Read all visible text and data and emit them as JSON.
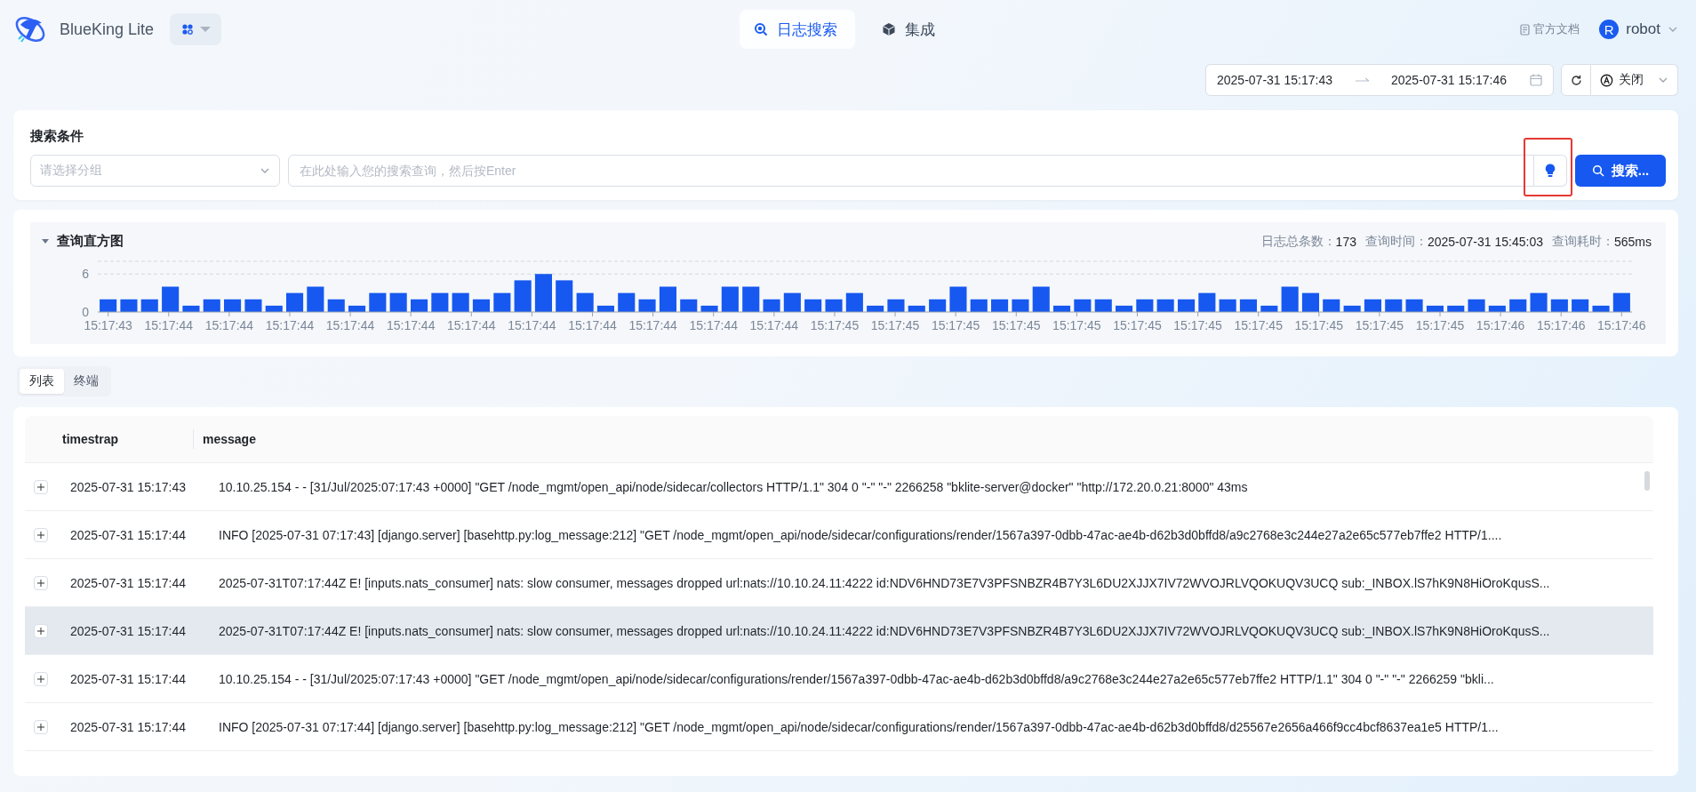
{
  "header": {
    "brand": "BlueKing Lite",
    "nav_tabs": [
      {
        "label": "日志搜索",
        "selected": true,
        "kind": "search"
      },
      {
        "label": "集成",
        "selected": false,
        "kind": "cube"
      }
    ],
    "docs_link": "官方文档",
    "user": {
      "avatar": "R",
      "name": "robot"
    }
  },
  "time_range": {
    "start": "2025-07-31 15:17:43",
    "end": "2025-07-31 15:17:46",
    "auto_refresh": "关闭"
  },
  "search": {
    "title": "搜索条件",
    "group_select": {
      "placeholder": "请选择分组"
    },
    "query": {
      "placeholder": "在此处输入您的搜索查询，然后按Enter"
    },
    "hint_highlighted": true,
    "search_button": "搜索..."
  },
  "histogram": {
    "title": "查询直方图",
    "expanded": true,
    "stats": [
      {
        "label": "日志总条数：",
        "value": "173"
      },
      {
        "label": "查询时间：",
        "value": "2025-07-31 15:45:03"
      },
      {
        "label": "查询耗时：",
        "value": "565ms"
      }
    ],
    "x_labels": [
      "15:17:43",
      "15:17:44",
      "15:17:44",
      "15:17:44",
      "15:17:44",
      "15:17:44",
      "15:17:44",
      "15:17:44",
      "15:17:44",
      "15:17:44",
      "15:17:44",
      "15:17:44",
      "15:17:45",
      "15:17:45",
      "15:17:45",
      "15:17:45",
      "15:17:45",
      "15:17:45",
      "15:17:45",
      "15:17:45",
      "15:17:45",
      "15:17:45",
      "15:17:45",
      "15:17:46",
      "15:17:46",
      "15:17:46"
    ],
    "chart_data": {
      "type": "bar",
      "ylim": [
        0,
        8
      ],
      "yticks": [
        0,
        6
      ],
      "values": [
        2,
        2,
        2,
        4,
        1,
        2,
        2,
        2,
        1,
        3,
        4,
        2,
        1,
        3,
        3,
        2,
        3,
        3,
        2,
        3,
        5,
        6,
        5,
        3,
        1,
        3,
        2,
        4,
        2,
        1,
        4,
        4,
        2,
        3,
        2,
        2,
        3,
        1,
        2,
        1,
        2,
        4,
        2,
        2,
        2,
        4,
        1,
        2,
        2,
        1,
        2,
        2,
        2,
        3,
        2,
        2,
        1,
        4,
        3,
        2,
        1,
        2,
        2,
        2,
        1,
        1,
        2,
        1,
        2,
        3,
        2,
        2,
        1,
        3
      ]
    }
  },
  "view_tabs": [
    {
      "label": "列表",
      "selected": true
    },
    {
      "label": "终端",
      "selected": false
    }
  ],
  "table": {
    "columns": [
      "timestrap",
      "message"
    ],
    "rows": [
      {
        "timestamp": "2025-07-31 15:17:43",
        "message": "10.10.25.154 - - [31/Jul/2025:07:17:43 +0000] \"GET /node_mgmt/open_api/node/sidecar/collectors HTTP/1.1\" 304 0 \"-\" \"-\" 2266258 \"bklite-server@docker\" \"http://172.20.0.21:8000\" 43ms",
        "hovered": false
      },
      {
        "timestamp": "2025-07-31 15:17:44",
        "message": "INFO [2025-07-31 07:17:43] [django.server] [basehttp.py:log_message:212] \"GET /node_mgmt/open_api/node/sidecar/configurations/render/1567a397-0dbb-47ac-ae4b-d62b3d0bffd8/a9c2768e3c244e27a2e65c577eb7ffe2 HTTP/1....",
        "hovered": false
      },
      {
        "timestamp": "2025-07-31 15:17:44",
        "message": "2025-07-31T07:17:44Z E! [inputs.nats_consumer] nats: slow consumer, messages dropped url:nats://10.10.24.11:4222 id:NDV6HND73E7V3PFSNBZR4B7Y3L6DU2XJJX7IV72WVOJRLVQOKUQV3UCQ sub:_INBOX.lS7hK9N8HiOroKqusS...",
        "hovered": false
      },
      {
        "timestamp": "2025-07-31 15:17:44",
        "message": "2025-07-31T07:17:44Z E! [inputs.nats_consumer] nats: slow consumer, messages dropped url:nats://10.10.24.11:4222 id:NDV6HND73E7V3PFSNBZR4B7Y3L6DU2XJJX7IV72WVOJRLVQOKUQV3UCQ sub:_INBOX.lS7hK9N8HiOroKqusS...",
        "hovered": true
      },
      {
        "timestamp": "2025-07-31 15:17:44",
        "message": "10.10.25.154 - - [31/Jul/2025:07:17:43 +0000] \"GET /node_mgmt/open_api/node/sidecar/configurations/render/1567a397-0dbb-47ac-ae4b-d62b3d0bffd8/a9c2768e3c244e27a2e65c577eb7ffe2 HTTP/1.1\" 304 0 \"-\" \"-\" 2266259 \"bkli...",
        "hovered": false
      },
      {
        "timestamp": "2025-07-31 15:17:44",
        "message": "INFO [2025-07-31 07:17:44] [django.server] [basehttp.py:log_message:212] \"GET /node_mgmt/open_api/node/sidecar/configurations/render/1567a397-0dbb-47ac-ae4b-d62b3d0bffd8/d25567e2656a466f9cc4bcf8637ea1e5 HTTP/1...",
        "hovered": false
      }
    ]
  }
}
